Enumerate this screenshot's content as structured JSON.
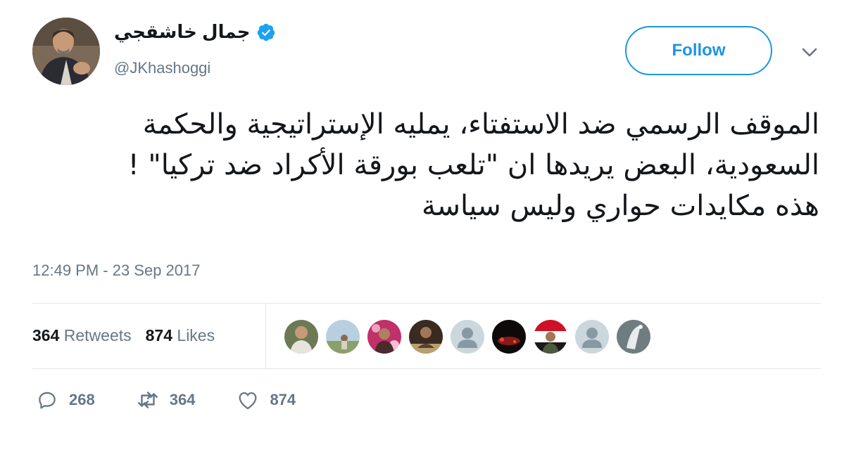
{
  "user": {
    "display_name": "جمال خاشقجي",
    "handle": "@JKhashoggi"
  },
  "follow_label": "Follow",
  "tweet": {
    "text": "الموقف الرسمي ضد الاستفتاء، يمليه الإستراتيجية والحكمة\nالسعودية، البعض يريدها ان \"تلعب بورقة الأكراد ضد تركيا\" !\nهذه مكايدات حواري وليس سياسة",
    "timestamp": "12:49 PM - 23 Sep 2017"
  },
  "stats": {
    "retweets_count": "364",
    "retweets_label": "Retweets",
    "likes_count": "874",
    "likes_label": "Likes"
  },
  "actions": {
    "replies": "268",
    "retweets": "364",
    "likes": "874"
  },
  "colors": {
    "accent": "#1b95e0",
    "secondary_text": "#657786",
    "divider": "#e1e8ed"
  }
}
